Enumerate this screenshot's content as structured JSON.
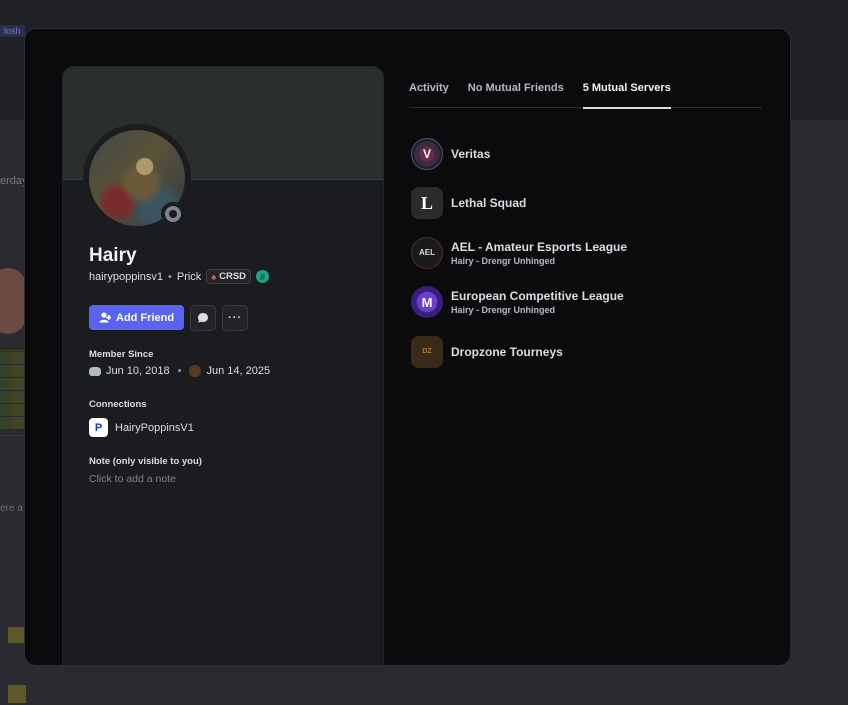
{
  "background": {
    "tag": "losh",
    "fragment1": "erday",
    "fragment2": "ere a"
  },
  "profile": {
    "display_name": "Hairy",
    "username": "hairypoppinsv1",
    "pronoun_title": "Prick",
    "clan_tag": "CRSD",
    "actions": {
      "add_friend": "Add Friend"
    },
    "member_since": {
      "title": "Member Since",
      "discord_date": "Jun 10, 2018",
      "server_date": "Jun 14, 2025"
    },
    "connections": {
      "title": "Connections",
      "items": [
        {
          "platform": "playstation-icon",
          "name": "HairyPoppinsV1"
        }
      ]
    },
    "note": {
      "title": "Note (only visible to you)",
      "placeholder": "Click to add a note"
    }
  },
  "tabs": [
    {
      "label": "Activity",
      "active": false
    },
    {
      "label": "No Mutual Friends",
      "active": false
    },
    {
      "label": "5 Mutual Servers",
      "active": true
    }
  ],
  "mutual_servers": [
    {
      "name": "Veritas",
      "nickname": "",
      "icon": "veritas-server-icon"
    },
    {
      "name": "Lethal Squad",
      "nickname": "",
      "icon": "lethal-squad-server-icon"
    },
    {
      "name": "AEL - Amateur Esports League",
      "nickname": "Hairy - Drengr Unhinged",
      "icon": "ael-server-icon"
    },
    {
      "name": "European Competitive League",
      "nickname": "Hairy - Drengr Unhinged",
      "icon": "ecl-server-icon"
    },
    {
      "name": "Dropzone Tourneys",
      "nickname": "",
      "icon": "dropzone-server-icon"
    }
  ],
  "colors": {
    "accent": "#5865f2",
    "modal_bg": "#0b0b0d",
    "card_bg": "#1b1c20",
    "status_offline": "#80848e"
  }
}
